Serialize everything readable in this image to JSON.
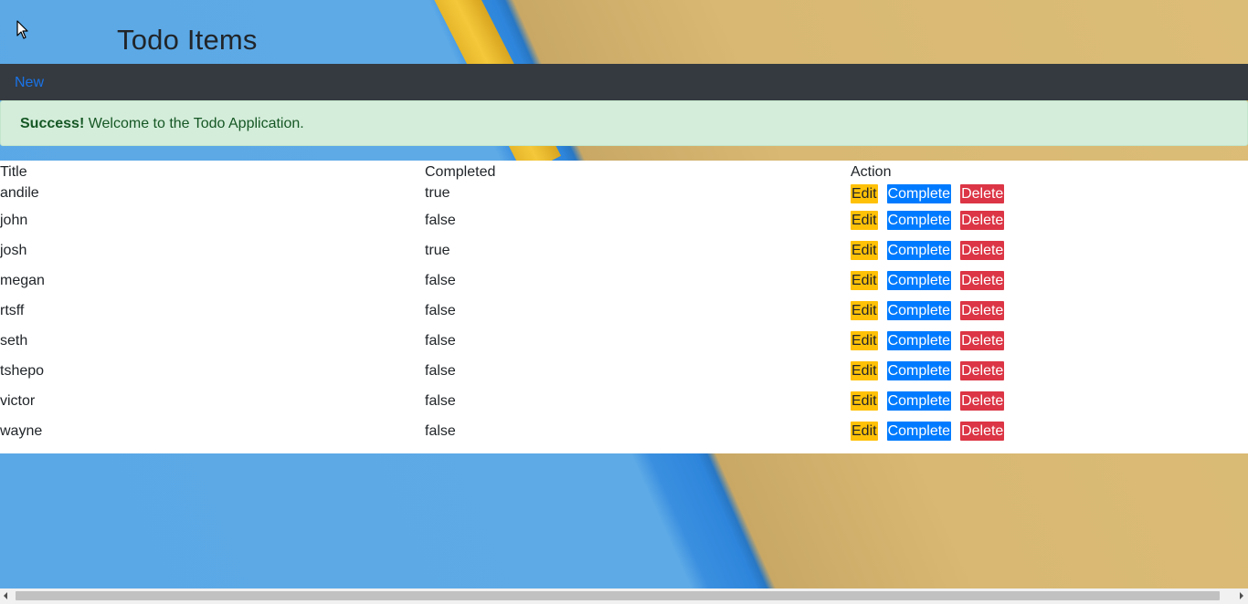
{
  "header": {
    "title": "Todo Items"
  },
  "nav": {
    "new_label": "New"
  },
  "alert": {
    "strong": "Success!",
    "message": " Welcome to the Todo Application."
  },
  "table": {
    "headers": {
      "title": "Title",
      "completed": "Completed",
      "action": "Action"
    },
    "rows": [
      {
        "title": "andile",
        "completed": "true"
      },
      {
        "title": "john",
        "completed": "false"
      },
      {
        "title": "josh",
        "completed": "true"
      },
      {
        "title": "megan",
        "completed": "false"
      },
      {
        "title": "rtsff",
        "completed": "false"
      },
      {
        "title": "seth",
        "completed": "false"
      },
      {
        "title": "tshepo",
        "completed": "false"
      },
      {
        "title": "victor",
        "completed": "false"
      },
      {
        "title": "wayne",
        "completed": "false"
      }
    ],
    "actions": {
      "edit_label": "Edit",
      "complete_label": "Complete",
      "delete_label": "Delete"
    }
  },
  "colors": {
    "navbar": "#343a40",
    "link": "#1a73e8",
    "alert_bg": "#d4edda",
    "alert_text": "#155724",
    "edit": "#ffc107",
    "complete": "#007bff",
    "delete": "#dc3545"
  },
  "icons": {
    "cursor": "mouse-pointer-icon",
    "scroll_left": "chevron-left-icon",
    "scroll_right": "chevron-right-icon"
  }
}
